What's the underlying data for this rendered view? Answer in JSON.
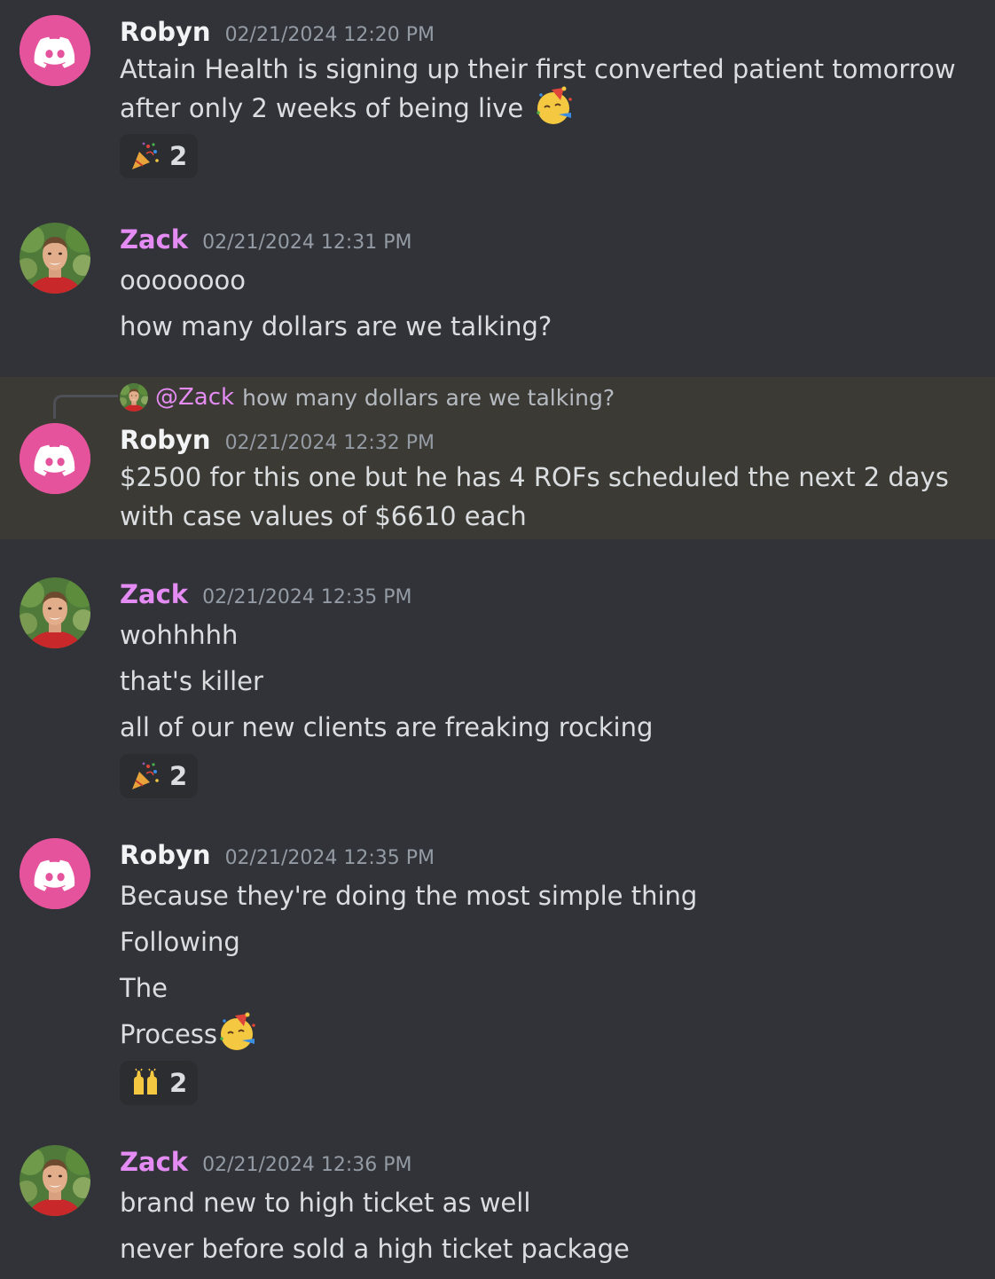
{
  "colors": {
    "background": "#313338",
    "highlight": "#3c3a35",
    "robyn_name": "#f2f3f5",
    "zack_name": "#e58cf4",
    "timestamp": "#949ba4",
    "discord_avatar": "#e5539d"
  },
  "messages": [
    {
      "author": "Robyn",
      "avatar": "discord-logo-icon",
      "timestamp": "02/21/2024 12:20 PM",
      "lines": [
        "Attain Health is signing up their first converted patient tomorrow after only 2 weeks of being live"
      ],
      "trailing_emoji": "partying-face-icon",
      "reaction": {
        "emoji": "party-popper-icon",
        "count": "2"
      }
    },
    {
      "author": "Zack",
      "avatar": "zack-photo-avatar",
      "timestamp": "02/21/2024 12:31 PM",
      "lines": [
        "oooooooo",
        "how many dollars are we talking?"
      ]
    },
    {
      "author": "Robyn",
      "avatar": "discord-logo-icon",
      "timestamp": "02/21/2024 12:32 PM",
      "reply_to": {
        "mention": "@Zack",
        "text": "how many dollars are we talking?"
      },
      "lines": [
        "$2500 for this one but he has 4 ROFs scheduled the next 2 days with case values of $6610 each"
      ],
      "highlighted": true
    },
    {
      "author": "Zack",
      "avatar": "zack-photo-avatar",
      "timestamp": "02/21/2024 12:35 PM",
      "lines": [
        "wohhhhh",
        "that's killer",
        "all of our new clients are freaking rocking"
      ],
      "reaction": {
        "emoji": "party-popper-icon",
        "count": "2"
      }
    },
    {
      "author": "Robyn",
      "avatar": "discord-logo-icon",
      "timestamp": "02/21/2024 12:35 PM",
      "lines": [
        "Because they're doing the most simple thing",
        "Following",
        "The",
        "Process"
      ],
      "trailing_emoji": "partying-face-icon",
      "reaction": {
        "emoji": "raising-hands-icon",
        "count": "2"
      }
    },
    {
      "author": "Zack",
      "avatar": "zack-photo-avatar",
      "timestamp": "02/21/2024 12:36 PM",
      "lines": [
        "brand new to high ticket as well",
        "never before sold a high ticket package"
      ]
    }
  ]
}
